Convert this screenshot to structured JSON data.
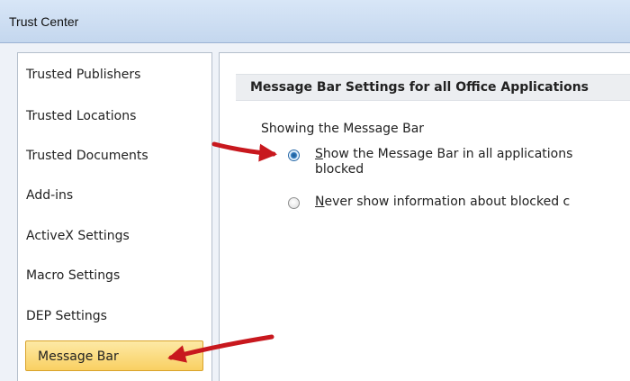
{
  "window": {
    "title": "Trust Center"
  },
  "nav": {
    "items": [
      {
        "label": "Trusted Publishers",
        "selected": false
      },
      {
        "label": "Trusted Locations",
        "selected": false
      },
      {
        "label": "Trusted Documents",
        "selected": false
      },
      {
        "label": "Add-ins",
        "selected": false
      },
      {
        "label": "ActiveX Settings",
        "selected": false
      },
      {
        "label": "Macro Settings",
        "selected": false
      },
      {
        "label": "DEP Settings",
        "selected": false
      },
      {
        "label": "Message Bar",
        "selected": true
      }
    ]
  },
  "content": {
    "section_title": "Message Bar Settings for all Office Applications",
    "group_label": "Showing the Message Bar",
    "options": [
      {
        "accel": "S",
        "label_rest": "how the Message Bar in all applications",
        "label_line2": "blocked",
        "checked": true
      },
      {
        "accel": "N",
        "label_rest": "ever show information about blocked c",
        "checked": false
      }
    ]
  },
  "colors": {
    "arrow": "#c8181e",
    "selected_bg": "#f9d062",
    "titlebar_bg": "#c4d7ee"
  },
  "annotations": [
    {
      "icon": "red-arrow-icon",
      "points_to": "Show the Message Bar radio option"
    },
    {
      "icon": "red-arrow-icon",
      "points_to": "Message Bar nav item"
    }
  ]
}
